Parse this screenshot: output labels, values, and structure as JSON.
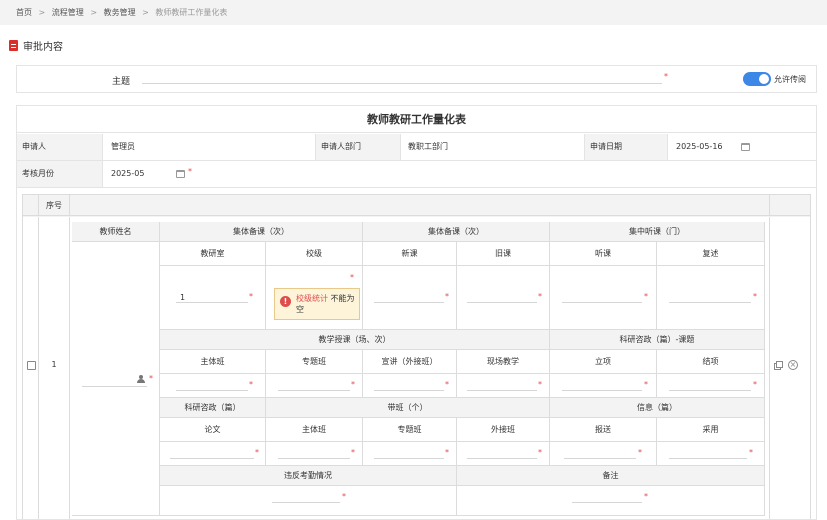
{
  "breadcrumb": {
    "items": [
      "首页",
      "流程管理",
      "教务管理"
    ],
    "current": "教师教研工作量化表",
    "separator": ">"
  },
  "section": {
    "title": "审批内容"
  },
  "subject": {
    "label": "主题",
    "required_mark": "*",
    "toggle_label": "允许传阅",
    "toggle_on": true
  },
  "form": {
    "title": "教师教研工作量化表",
    "applicant_label": "申请人",
    "applicant_value": "管理员",
    "dept_label": "申请人部门",
    "dept_value": "教职工部门",
    "date_label": "申请日期",
    "date_value": "2025-05-16",
    "month_label": "考核月份",
    "month_value": "2025-05",
    "required_mark": "*"
  },
  "detail": {
    "seq_header": "序号",
    "row_number": "1",
    "teacher_name_header": "教师姓名",
    "groups": {
      "collective_prep_1": "集体备课（次）",
      "collective_prep_2": "集体备课（次）",
      "lecture_listen": "集中听课（门）",
      "teaching": "教学授课（场、次）",
      "research_topic": "科研咨政（篇）-课题",
      "research_paper": "科研咨政（篇）",
      "class_lead": "带班（个）",
      "info": "信息（篇）",
      "attendance": "违反考勤情况",
      "remark": "备注"
    },
    "subs": {
      "office": "教研室",
      "school": "校级",
      "new_course": "新课",
      "old_course": "旧课",
      "listen": "听课",
      "recap": "复述",
      "main_class": "主体班",
      "special_class": "专题班",
      "outreach": "宣讲（外接班）",
      "onsite": "现场教学",
      "project_setup": "立项",
      "project_close": "结项",
      "paper": "论文",
      "main_class2": "主体班",
      "special_class2": "专题班",
      "external_class": "外接班",
      "submit": "报送",
      "adopt": "采用"
    },
    "office_value": "1",
    "error": {
      "field": "校级统计",
      "message": "不能为空"
    },
    "required_mark": "*"
  },
  "icons": {
    "doc": "document-icon",
    "calendar": "calendar-icon",
    "user_picker": "user-picker-icon",
    "copy": "copy-icon",
    "delete": "delete-icon",
    "error": "error-icon",
    "error_symbol": "!",
    "delete_symbol": "×"
  },
  "colors": {
    "accent": "#3d87e6",
    "required": "#e04b4b",
    "error_bg": "#fdf4d9"
  }
}
